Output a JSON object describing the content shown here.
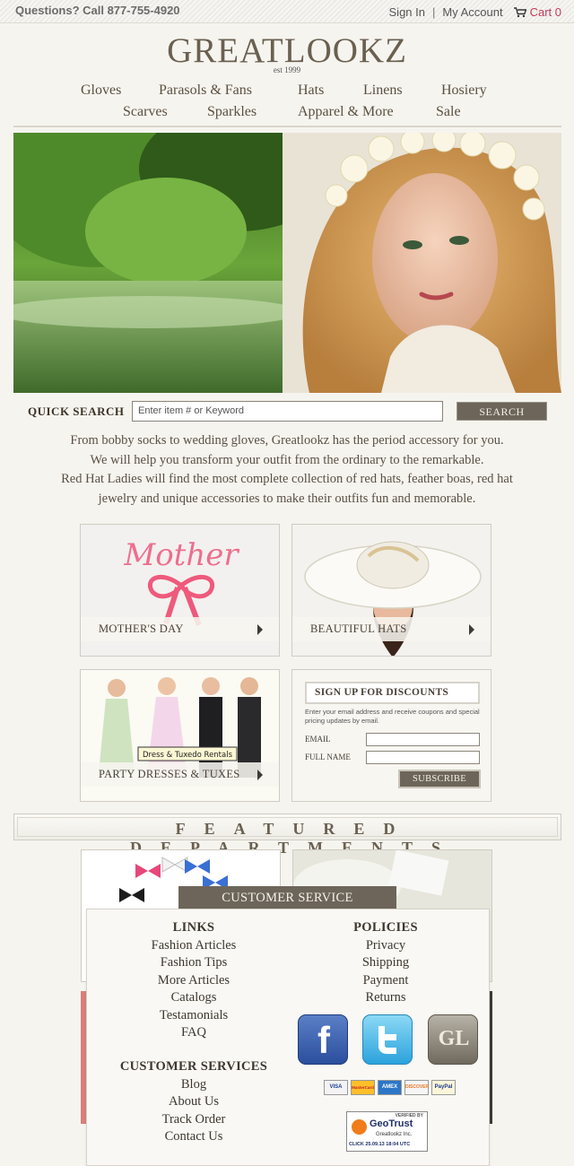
{
  "topbar": {
    "phone": "Questions? Call 877-755-4920",
    "sign_in": "Sign In",
    "separator": "|",
    "my_account": "My Account",
    "cart": "Cart 0"
  },
  "logo": {
    "name": "GREATLOOKZ",
    "est": "est 1999"
  },
  "nav": {
    "row1": [
      "Gloves",
      "Parasols & Fans",
      "Hats",
      "Linens",
      "Hosiery"
    ],
    "row2": [
      "Scarves",
      "Sparkles",
      "Apparel & More",
      "Sale"
    ]
  },
  "search": {
    "label": "QUICK SEARCH",
    "placeholder": "Enter item # or Keyword",
    "button": "SEARCH"
  },
  "intro": {
    "line1": "From bobby socks to wedding gloves, Greatlookz has the period accessory for you.",
    "line2": "We will help you transform  your outfit from the ordinary to the remarkable.",
    "line3": "Red Hat Ladies will find the most complete collection of red hats, feather boas, red hat",
    "line4": "jewelry and unique accessories to make their outfits fun and memorable."
  },
  "tiles": {
    "mothers_day": {
      "label": "MOTHER'S DAY",
      "image_text": "Mother"
    },
    "hats": {
      "label": "BEAUTIFUL HATS"
    },
    "party": {
      "label": "PARTY DRESSES & TUXES",
      "image_text": "Dress & Tuxedo Rentals"
    }
  },
  "signup": {
    "heading": "SIGN UP FOR DISCOUNTS",
    "description": "Enter your email address and receive coupons and special pricing updates by email.",
    "email_label": "EMAIL",
    "name_label": "FULL NAME",
    "button": "SUBSCRIBE"
  },
  "featured": {
    "title": "FEATURED DEPARTMENTS"
  },
  "customer_service": {
    "tab": "CUSTOMER SERVICE",
    "links_heading": "LINKS",
    "links": [
      "Fashion Articles",
      "Fashion Tips",
      "More Articles",
      "Catalogs",
      "Testamonials",
      "FAQ"
    ],
    "policies_heading": "POLICIES",
    "policies": [
      "Privacy",
      "Shipping",
      "Payment",
      "Returns"
    ],
    "services_heading": "CUSTOMER SERVICES",
    "services": [
      "Blog",
      "About Us",
      "Track Order",
      "Contact Us"
    ],
    "social": {
      "facebook": "f",
      "greatlookz": "GL"
    },
    "cards": [
      "VISA",
      "MasterCard",
      "AMEX",
      "DISCOVER",
      "PayPal"
    ],
    "geotrust": {
      "verified": "VERIFIED BY",
      "brand": "GeoTrust",
      "company": "Greatlookz Inc.",
      "click": "CLICK 25.09.13 18:04 UTC"
    }
  },
  "colors": {
    "accent_dark": "#6d655a",
    "cart_pink": "#c33c5a",
    "background": "#f6f4ef"
  }
}
